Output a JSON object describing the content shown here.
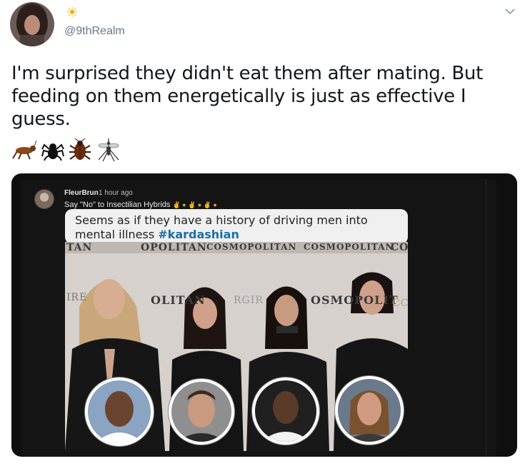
{
  "tweet": {
    "handle": "@9thRealm",
    "text": "I'm surprised they didn't eat them after mating. But feeding on them energetically is just as effective I guess.",
    "emoji_icons": [
      "cricket-icon",
      "spider-icon",
      "cockroach-icon",
      "mosquito-icon"
    ]
  },
  "embedded_comment": {
    "author": "FleurBrun",
    "time": "1 hour ago",
    "bio": "Say \"No\" to Insectilian Hybrids",
    "quote_text": "Seems as if they have a history of driving men into mental illness ",
    "quote_hashtag": "#kardashian"
  },
  "photo": {
    "banner_words": [
      "TAN",
      "OPOLITAN",
      "COSMOPOLITAN",
      "COSMOPOLITAN",
      "CO",
      "IRE",
      "OLITAN",
      "RGIR",
      "OSMOPOLIT",
      "CC"
    ]
  },
  "colors": {
    "accent": "#1a6fa8",
    "handle_gray": "#657786",
    "sun": "#f5b100"
  }
}
